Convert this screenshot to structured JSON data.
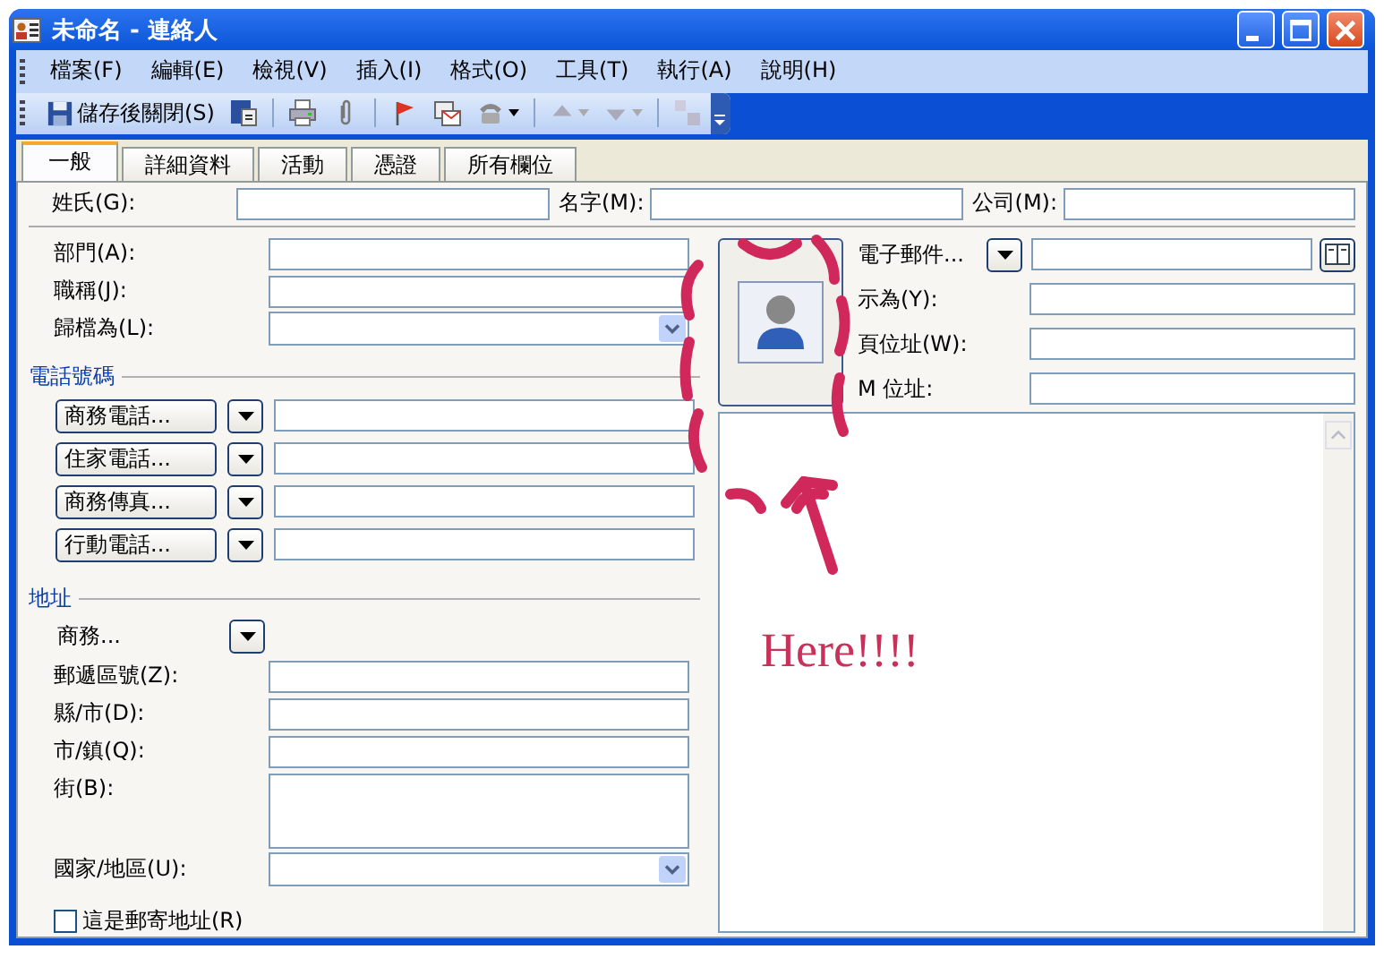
{
  "window": {
    "title": "未命名 - 連絡人"
  },
  "menu": [
    "檔案(F)",
    "編輯(E)",
    "檢視(V)",
    "插入(I)",
    "格式(O)",
    "工具(T)",
    "執行(A)",
    "說明(H)"
  ],
  "toolbar": {
    "save_close": "儲存後關閉(S)"
  },
  "tabs": [
    {
      "label": "一般",
      "selected": true
    },
    {
      "label": "詳細資料",
      "selected": false
    },
    {
      "label": "活動",
      "selected": false
    },
    {
      "label": "憑證",
      "selected": false
    },
    {
      "label": "所有欄位",
      "selected": false
    }
  ],
  "name_row": {
    "last_name_label": "姓氏(G):",
    "first_name_label": "名字(M):",
    "company_label": "公司(M):"
  },
  "work_fields": [
    {
      "label": "部門(A):",
      "kind": "text"
    },
    {
      "label": "職稱(J):",
      "kind": "text"
    },
    {
      "label": "歸檔為(L):",
      "kind": "dropdown"
    }
  ],
  "phone_section": {
    "title": "電話號碼",
    "buttons": [
      "商務電話...",
      "住家電話...",
      "商務傳真...",
      "行動電話..."
    ]
  },
  "address_section": {
    "title": "地址",
    "type_label": "商務...",
    "fields": [
      {
        "label": "郵遞區號(Z):",
        "kind": "text"
      },
      {
        "label": "縣/市(D):",
        "kind": "text"
      },
      {
        "label": "市/鎮(Q):",
        "kind": "text"
      },
      {
        "label": "街(B):",
        "kind": "multiline"
      },
      {
        "label": "國家/地區(U):",
        "kind": "dropdown"
      }
    ],
    "mailing_checkbox": {
      "label": "這是郵寄地址(R)",
      "checked": false
    }
  },
  "email": {
    "label": "電子郵件..."
  },
  "internet_fields": [
    {
      "label": "示為(Y):"
    },
    {
      "label": "頁位址(W):"
    },
    {
      "label": "M 位址:"
    }
  ],
  "annotation": {
    "text": "Here!!!!"
  }
}
